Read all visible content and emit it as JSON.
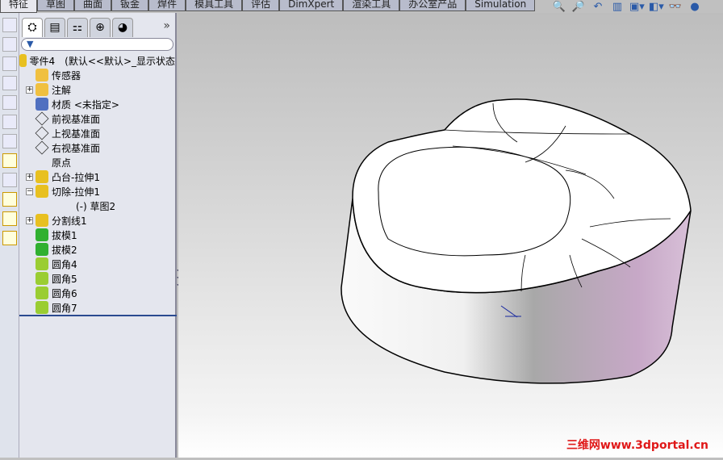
{
  "command_tabs": [
    "特征",
    "草图",
    "曲面",
    "钣金",
    "焊件",
    "模具工具",
    "评估",
    "DimXpert",
    "渲染工具",
    "办公室产品",
    "Simulation"
  ],
  "active_tab": "特征",
  "view_tools": [
    "zoom-to-fit-icon",
    "zoom-area-icon",
    "previous-view-icon",
    "section-view-icon",
    "view-orientation-icon",
    "display-style-icon",
    "hide-show-icon",
    "appearance-icon"
  ],
  "panel_tabs": [
    "featuremanager-icon",
    "propertymanager-icon",
    "configurationmanager-icon",
    "dimxpert-icon",
    "display-manager-icon"
  ],
  "panel_more": "»",
  "tree": {
    "root": "零件4　(默认<<默认>_显示状态",
    "items": [
      {
        "label": "传感器",
        "icon": "sensor-folder-icon",
        "expand": ""
      },
      {
        "label": "注解",
        "icon": "annotations-folder-icon",
        "expand": "+"
      },
      {
        "label": "材质 <未指定>",
        "icon": "material-icon",
        "expand": ""
      },
      {
        "label": "前视基准面",
        "icon": "plane-icon",
        "expand": ""
      },
      {
        "label": "上视基准面",
        "icon": "plane-icon",
        "expand": ""
      },
      {
        "label": "右视基准面",
        "icon": "plane-icon",
        "expand": ""
      },
      {
        "label": "原点",
        "icon": "origin-icon",
        "expand": ""
      },
      {
        "label": "凸台-拉伸1",
        "icon": "boss-extrude-icon",
        "expand": "+"
      },
      {
        "label": "切除-拉伸1",
        "icon": "cut-extrude-icon",
        "expand": "−"
      },
      {
        "label": "(-) 草图2",
        "icon": "sketch-icon",
        "expand": "",
        "indent": true
      },
      {
        "label": "分割线1",
        "icon": "split-line-icon",
        "expand": "+"
      },
      {
        "label": "拔模1",
        "icon": "draft-icon",
        "expand": ""
      },
      {
        "label": "拔模2",
        "icon": "draft-icon",
        "expand": ""
      },
      {
        "label": "圆角4",
        "icon": "fillet-icon",
        "expand": ""
      },
      {
        "label": "圆角5",
        "icon": "fillet-icon",
        "expand": ""
      },
      {
        "label": "圆角6",
        "icon": "fillet-icon",
        "expand": ""
      },
      {
        "label": "圆角7",
        "icon": "fillet-icon",
        "expand": ""
      }
    ]
  },
  "watermark": "三维网www.3dportal.cn"
}
